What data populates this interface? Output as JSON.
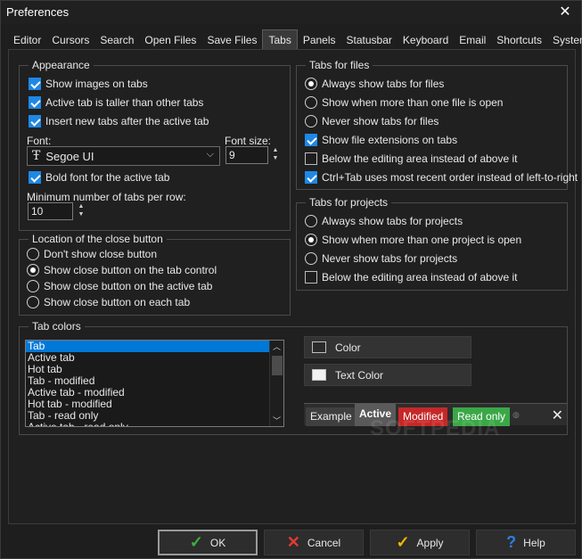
{
  "window": {
    "title": "Preferences"
  },
  "tabs": [
    "Editor",
    "Cursors",
    "Search",
    "Open Files",
    "Save Files",
    "Tabs",
    "Panels",
    "Statusbar",
    "Keyboard",
    "Email",
    "Shortcuts",
    "System"
  ],
  "appearance": {
    "legend": "Appearance",
    "show_images": "Show images on tabs",
    "active_taller": "Active tab is taller than other tabs",
    "insert_after": "Insert new tabs after the active tab",
    "font_label": "Font:",
    "font_value": "Segoe UI",
    "font_size_label": "Font size:",
    "font_size_value": "9",
    "bold_font": "Bold font for the active tab",
    "min_tabs_label": "Minimum number of tabs per row:",
    "min_tabs_value": "10"
  },
  "close_button": {
    "legend": "Location of the close button",
    "options": [
      "Don't show close button",
      "Show close button on the tab control",
      "Show close button on the active tab",
      "Show close button on each tab"
    ],
    "selected": 1
  },
  "tabs_for_files": {
    "legend": "Tabs for files",
    "radios": [
      "Always show tabs for files",
      "Show when more than one file is open",
      "Never show tabs for files"
    ],
    "selected": 0,
    "show_ext": "Show file extensions on tabs",
    "below_editing": "Below the editing area instead of above it",
    "ctrl_tab": "Ctrl+Tab uses most recent order instead of left-to-right"
  },
  "tabs_for_projects": {
    "legend": "Tabs for projects",
    "radios": [
      "Always show tabs for projects",
      "Show when more than one project is open",
      "Never show tabs for projects"
    ],
    "selected": 1,
    "below_editing": "Below the editing area instead of above it"
  },
  "tab_colors": {
    "legend": "Tab colors",
    "items": [
      "Tab",
      "Active tab",
      "Hot tab",
      "Tab - modified",
      "Active tab - modified",
      "Hot tab - modified",
      "Tab - read only",
      "Active tab - read only"
    ],
    "selected": 0,
    "color_btn": "Color",
    "text_color_btn": "Text Color",
    "swatch_color": "#2b2b2b",
    "text_swatch_color": "#f2f2f2"
  },
  "preview_tabs": {
    "example": "Example",
    "active": "Active",
    "modified": "Modified",
    "read_only": "Read only",
    "modified_color": "#c62828",
    "read_only_color": "#3aa847"
  },
  "buttons": {
    "ok": "OK",
    "cancel": "Cancel",
    "apply": "Apply",
    "help": "Help"
  },
  "watermark": "SOFTPEDIA"
}
